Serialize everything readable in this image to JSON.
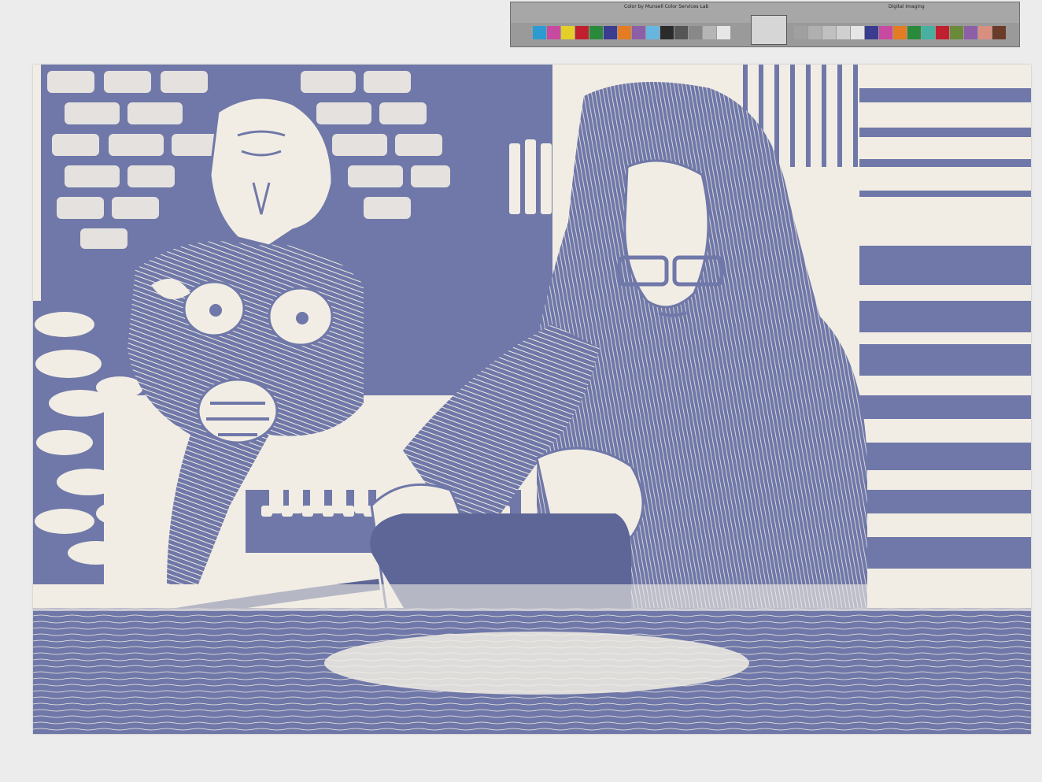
{
  "image": {
    "ink_color": "#6f78a8",
    "ink_dark": "#5d6697",
    "paper_color": "#f2ede4",
    "background_color": "#ececec"
  },
  "color_target": {
    "header_text_left": "Color by Munsell Color Services Lab",
    "header_text_right": "Digital Imaging",
    "patches_left": [
      "#2d9bd1",
      "#c84aa0",
      "#e4cf2a",
      "#c0202e",
      "#2a8a3c",
      "#3a3d8f",
      "#e37c22",
      "#8d5fa6",
      "#66b6e0",
      "#2b2b2b",
      "#555555",
      "#888888",
      "#b5b5b5",
      "#e6e6e6"
    ],
    "patches_right": [
      "#a0a0a0",
      "#b0b0b0",
      "#c0c0c0",
      "#d0d0d0",
      "#e6e6e6",
      "#3a3d8f",
      "#c84aa0",
      "#e37c22",
      "#2a8a3c",
      "#47b0a0",
      "#c0202e",
      "#6a8a3a",
      "#8d5fa6",
      "#d98f7f",
      "#6b3b2a"
    ]
  }
}
